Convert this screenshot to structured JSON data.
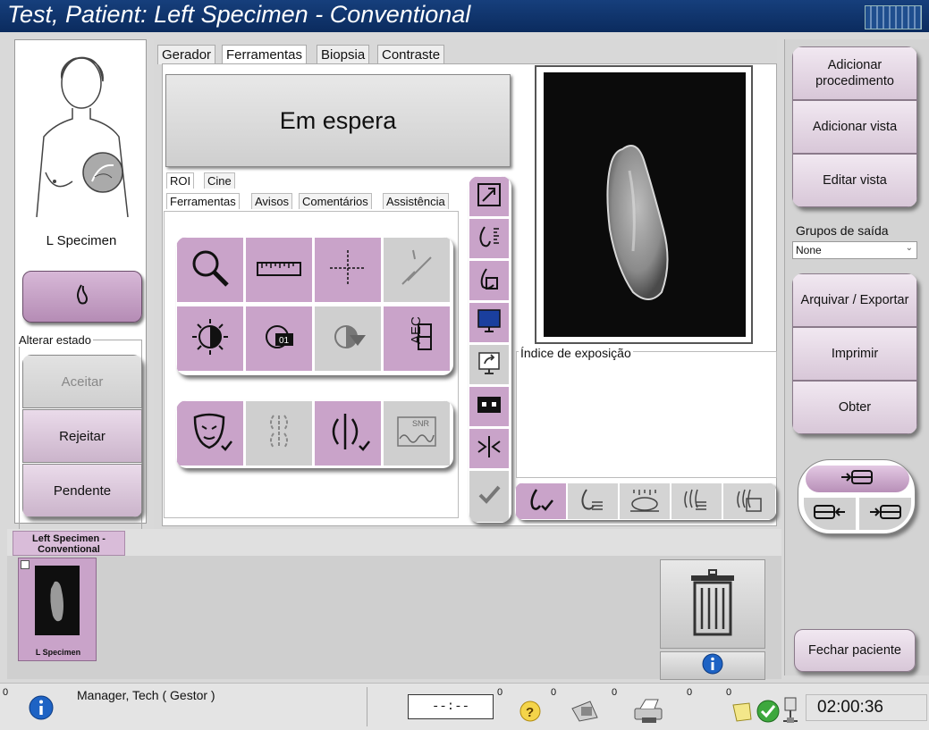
{
  "window": {
    "title": "Test, Patient: Left Specimen - Conventional"
  },
  "left": {
    "view_label": "L Specimen",
    "alter_state_label": "Alterar estado",
    "accept": "Aceitar",
    "reject": "Rejeitar",
    "pending": "Pendente"
  },
  "tabs": [
    "Gerador",
    "Ferramentas",
    "Biopsia",
    "Contraste"
  ],
  "active_tab": "Ferramentas",
  "status_box": {
    "text": "Em espera"
  },
  "subtabs_row1": [
    "ROI",
    "Cine"
  ],
  "subtabs_row2": [
    "Ferramentas",
    "Avisos",
    "Comentários",
    "Assistência"
  ],
  "image": {
    "exposure_index_label": "Índice de exposição"
  },
  "right": {
    "add_procedure": "Adicionar procedimento",
    "add_view": "Adicionar vista",
    "edit_view": "Editar vista",
    "output_groups_label": "Grupos de saída",
    "output_groups_value": "None",
    "archive_export": "Arquivar / Exportar",
    "print": "Imprimir",
    "retrieve": "Obter",
    "close_patient": "Fechar paciente"
  },
  "thumb": {
    "tab_label": "Left Specimen - Conventional",
    "caption": "L Specimen"
  },
  "statusbar": {
    "user": "Manager, Tech ( Gestor )",
    "count_left": "0",
    "clock_display": "--:--",
    "count1": "0",
    "count2": "0",
    "count3": "0",
    "count4": "0",
    "count5": "0",
    "time": "02:00:36"
  },
  "colors": {
    "titlebar": "#0b2b5e",
    "accent_purple": "#c9a3c9",
    "selected_purple": "#9b6f9b"
  }
}
